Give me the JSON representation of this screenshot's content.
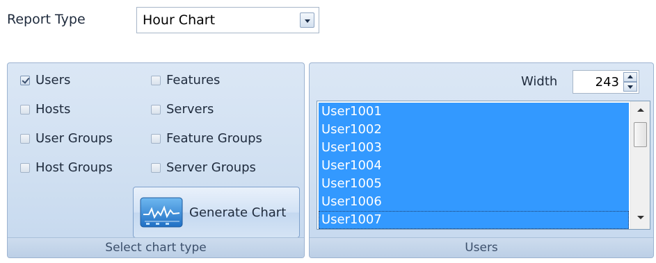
{
  "report_type": {
    "label": "Report Type",
    "selected": "Hour Chart"
  },
  "chart_type_panel": {
    "caption": "Select chart type",
    "checkboxes": [
      {
        "label": "Users",
        "checked": true
      },
      {
        "label": "Features",
        "checked": false
      },
      {
        "label": "Hosts",
        "checked": false
      },
      {
        "label": "Servers",
        "checked": false
      },
      {
        "label": "User Groups",
        "checked": false
      },
      {
        "label": "Feature Groups",
        "checked": false
      },
      {
        "label": "Host Groups",
        "checked": false
      },
      {
        "label": "Server Groups",
        "checked": false
      }
    ],
    "generate_button": {
      "label": "Generate Chart",
      "icon": "line-chart-icon"
    }
  },
  "users_panel": {
    "caption": "Users",
    "width_label": "Width",
    "width_value": "243",
    "items": [
      "User1001",
      "User1002",
      "User1003",
      "User1004",
      "User1005",
      "User1006",
      "User1007"
    ],
    "focused_item": "User1007"
  },
  "colors": {
    "selection": "#3399ff",
    "panel_background": "#d4e3f4",
    "panel_border": "#9cb3d1"
  }
}
